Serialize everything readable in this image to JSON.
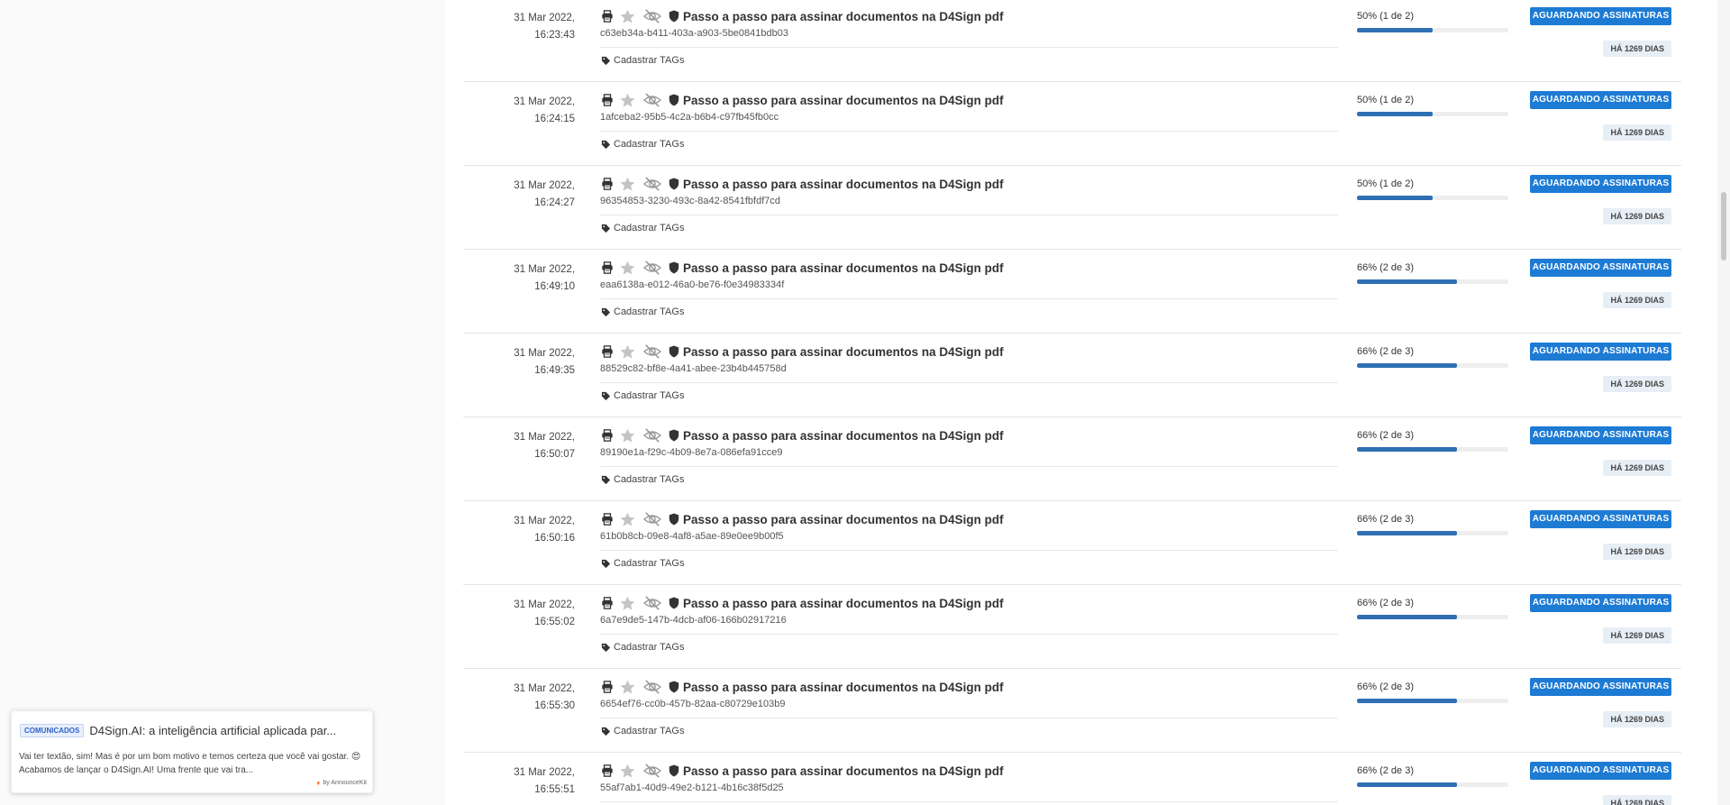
{
  "documents": [
    {
      "date": "31 Mar 2022,",
      "time": "16:23:43",
      "title": "Passo a passo para assinar documentos na D4Sign pdf",
      "id": "c63eb34a-b411-403a-a903-5be0841bdb03",
      "tags_label": "Cadastrar TAGs",
      "progress_label": "50% (1 de 2)",
      "progress_fraction": 0.5,
      "status": "AGUARDANDO ASSINATURAS",
      "age": "HÁ 1269 DIAS"
    },
    {
      "date": "31 Mar 2022,",
      "time": "16:24:15",
      "title": "Passo a passo para assinar documentos na D4Sign pdf",
      "id": "1afceba2-95b5-4c2a-b6b4-c97fb45fb0cc",
      "tags_label": "Cadastrar TAGs",
      "progress_label": "50% (1 de 2)",
      "progress_fraction": 0.5,
      "status": "AGUARDANDO ASSINATURAS",
      "age": "HÁ 1269 DIAS"
    },
    {
      "date": "31 Mar 2022,",
      "time": "16:24:27",
      "title": "Passo a passo para assinar documentos na D4Sign pdf",
      "id": "96354853-3230-493c-8a42-8541fbfdf7cd",
      "tags_label": "Cadastrar TAGs",
      "progress_label": "50% (1 de 2)",
      "progress_fraction": 0.5,
      "status": "AGUARDANDO ASSINATURAS",
      "age": "HÁ 1269 DIAS"
    },
    {
      "date": "31 Mar 2022,",
      "time": "16:49:10",
      "title": "Passo a passo para assinar documentos na D4Sign pdf",
      "id": "eaa6138a-e012-46a0-be76-f0e34983334f",
      "tags_label": "Cadastrar TAGs",
      "progress_label": "66% (2 de 3)",
      "progress_fraction": 0.66,
      "status": "AGUARDANDO ASSINATURAS",
      "age": "HÁ 1269 DIAS"
    },
    {
      "date": "31 Mar 2022,",
      "time": "16:49:35",
      "title": "Passo a passo para assinar documentos na D4Sign pdf",
      "id": "88529c82-bf8e-4a41-abee-23b4b445758d",
      "tags_label": "Cadastrar TAGs",
      "progress_label": "66% (2 de 3)",
      "progress_fraction": 0.66,
      "status": "AGUARDANDO ASSINATURAS",
      "age": "HÁ 1269 DIAS"
    },
    {
      "date": "31 Mar 2022,",
      "time": "16:50:07",
      "title": "Passo a passo para assinar documentos na D4Sign pdf",
      "id": "89190e1a-f29c-4b09-8e7a-086efa91cce9",
      "tags_label": "Cadastrar TAGs",
      "progress_label": "66% (2 de 3)",
      "progress_fraction": 0.66,
      "status": "AGUARDANDO ASSINATURAS",
      "age": "HÁ 1269 DIAS"
    },
    {
      "date": "31 Mar 2022,",
      "time": "16:50:16",
      "title": "Passo a passo para assinar documentos na D4Sign pdf",
      "id": "61b0b8cb-09e8-4af8-a5ae-89e0ee9b00f5",
      "tags_label": "Cadastrar TAGs",
      "progress_label": "66% (2 de 3)",
      "progress_fraction": 0.66,
      "status": "AGUARDANDO ASSINATURAS",
      "age": "HÁ 1269 DIAS"
    },
    {
      "date": "31 Mar 2022,",
      "time": "16:55:02",
      "title": "Passo a passo para assinar documentos na D4Sign pdf",
      "id": "6a7e9de5-147b-4dcb-af06-166b02917216",
      "tags_label": "Cadastrar TAGs",
      "progress_label": "66% (2 de 3)",
      "progress_fraction": 0.66,
      "status": "AGUARDANDO ASSINATURAS",
      "age": "HÁ 1269 DIAS"
    },
    {
      "date": "31 Mar 2022,",
      "time": "16:55:30",
      "title": "Passo a passo para assinar documentos na D4Sign pdf",
      "id": "6654ef76-cc0b-457b-82aa-c80729e103b9",
      "tags_label": "Cadastrar TAGs",
      "progress_label": "66% (2 de 3)",
      "progress_fraction": 0.66,
      "status": "AGUARDANDO ASSINATURAS",
      "age": "HÁ 1269 DIAS"
    },
    {
      "date": "31 Mar 2022,",
      "time": "16:55:51",
      "title": "Passo a passo para assinar documentos na D4Sign pdf",
      "id": "55af7ab1-40d9-49e2-b121-4b16c38f5d25",
      "tags_label": "Cadastrar TAGs",
      "progress_label": "66% (2 de 3)",
      "progress_fraction": 0.66,
      "status": "AGUARDANDO ASSINATURAS",
      "age": "HÁ 1269 DIAS"
    }
  ],
  "announcement": {
    "badge": "COMUNICADOS",
    "title": "D4Sign.AI: a inteligência artificial aplicada par...",
    "body": "Vai ter textão, sim! Mas é por um bom motivo e temos certeza que você vai gostar. 😍  Acabamos de lançar o D4Sign.AI! Uma frente que vai tra...",
    "footer": "by AnnounceKit"
  },
  "icons": {
    "print": "print-icon",
    "star": "star-icon",
    "visibility": "eye-slash-icon",
    "security": "shield-icon",
    "tag": "tag-icon"
  },
  "colors": {
    "status_button": "#1e7bd4",
    "progress_fill": "#2f6fb3",
    "age_badge_bg": "#e7eef6"
  }
}
